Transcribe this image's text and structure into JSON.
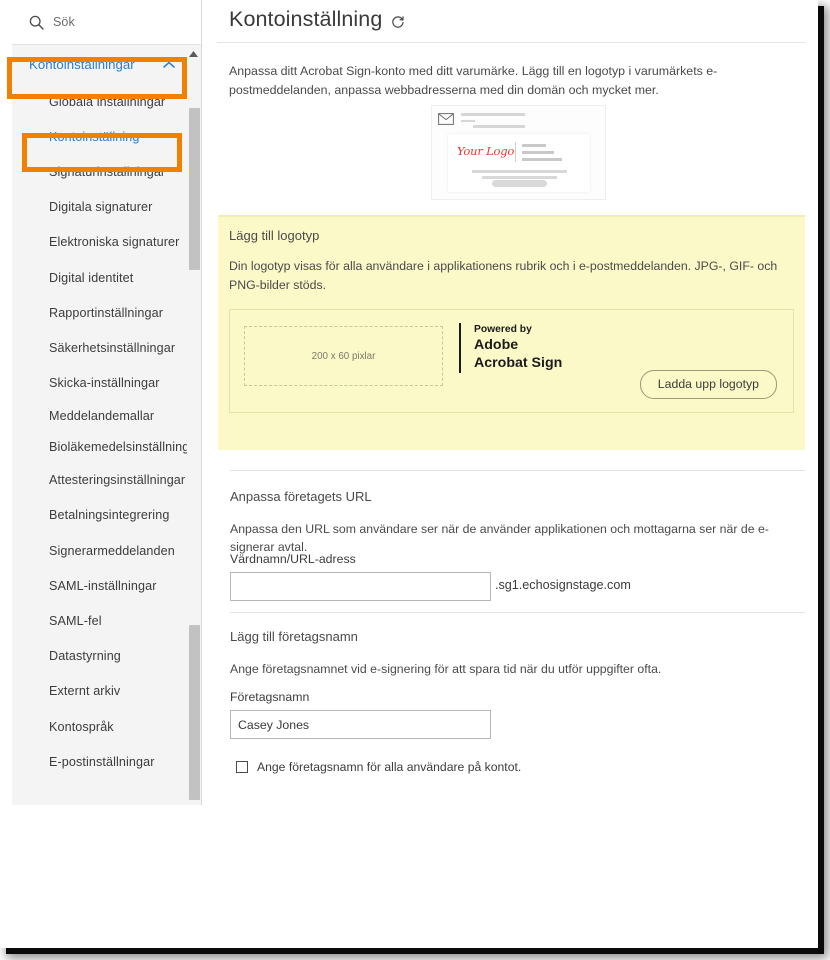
{
  "sidebar": {
    "search": {
      "placeholder": "Sök",
      "icon": "search-icon"
    },
    "group": {
      "label": "Kontoinställningar",
      "icon": "chevron-up-icon"
    },
    "items": [
      {
        "label": "Globala inställningar",
        "active": false
      },
      {
        "label": "Kontoinställning",
        "active": true
      },
      {
        "label": "Signaturinställningar",
        "active": false
      },
      {
        "label": "Digitala signaturer",
        "active": false
      },
      {
        "label": "Elektroniska signaturer",
        "active": false
      },
      {
        "label": "Digital identitet",
        "active": false
      },
      {
        "label": "Rapportinställningar",
        "active": false
      },
      {
        "label": "Säkerhetsinställningar",
        "active": false
      },
      {
        "label": "Skicka-inställningar",
        "active": false
      },
      {
        "label": "Meddelandemallar",
        "active": false
      },
      {
        "label": "Bioläkemedelsinställningar",
        "active": false
      },
      {
        "label": "Attesteringsinställningar",
        "active": false
      },
      {
        "label": "Betalningsintegrering",
        "active": false
      },
      {
        "label": "Signerarmeddelanden",
        "active": false
      },
      {
        "label": "SAML-inställningar",
        "active": false
      },
      {
        "label": "SAML-fel",
        "active": false
      },
      {
        "label": "Datastyrning",
        "active": false
      },
      {
        "label": "Externt arkiv",
        "active": false
      },
      {
        "label": "Kontospråk",
        "active": false
      },
      {
        "label": "E-postinställningar",
        "active": false
      }
    ]
  },
  "header": {
    "title": "Kontoinställning",
    "refresh_icon": "refresh-icon"
  },
  "main": {
    "intro": "Anpassa ditt Acrobat Sign-konto med ditt varumärke. Lägg till en logotyp i varumärkets e-postmeddelanden, anpassa webbadresserna med din domän och mycket mer.",
    "email_preview": {
      "logo_text": "Your Logo",
      "mail_icon": "envelope-icon"
    }
  },
  "logo_section": {
    "heading": "Lägg till logotyp",
    "description": "Din logotyp visas för alla användare i applikationens rubrik och i e-postmeddelanden. JPG-, GIF- och PNG-bilder stöds.",
    "dropzone_text": "200 x 60 pixlar",
    "powered_line1": "Powered by",
    "powered_line2": "Adobe",
    "powered_line3": "Acrobat Sign",
    "upload_button": "Ladda upp logotyp"
  },
  "url_section": {
    "heading": "Anpassa företagets URL",
    "description": "Anpassa den URL som användare ser när de använder applikationen och mottagarna ser när de e-signerar avtal.",
    "field_label": "Värdnamn/URL-adress",
    "field_value": "",
    "suffix": ".sg1.echosignstage.com"
  },
  "company_section": {
    "heading": "Lägg till företagsnamn",
    "description": "Ange företagsnamnet vid e-signering för att spara tid när du utför uppgifter ofta.",
    "field_label": "Företagsnamn",
    "field_value": "Casey Jones",
    "checkbox_label": "Ange företagsnamn för alla användare på kontot.",
    "checkbox_checked": false
  },
  "colors": {
    "accent_blue": "#2b7cd3",
    "annotation_orange": "#f08000",
    "highlight_yellow": "#fbf9c7",
    "logo_red": "#e8392e"
  }
}
